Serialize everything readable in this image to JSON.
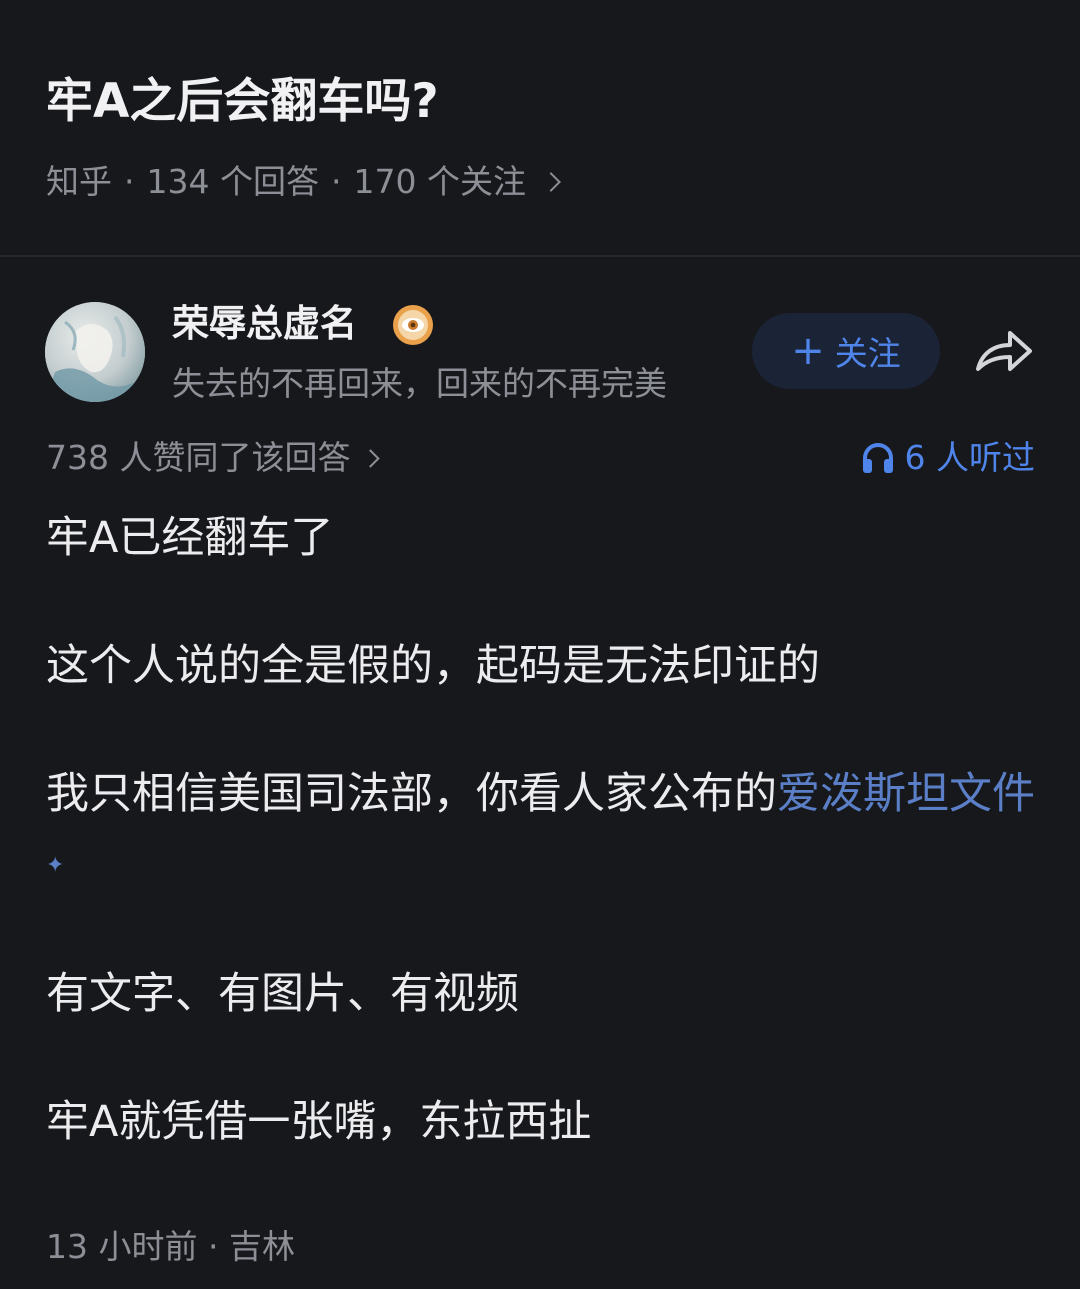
{
  "question": {
    "title": "牢A之后会翻车吗?",
    "source": "知乎",
    "answers": "134 个回答",
    "followers": "170 个关注",
    "separator": "·"
  },
  "author": {
    "name": "荣辱总虚名",
    "bio": "失去的不再回来，回来的不再完美",
    "follow_label": "关注",
    "follow_plus": "+"
  },
  "stats": {
    "votes": "738 人赞同了该回答",
    "listens": "6 人听过"
  },
  "answer": {
    "p1": "牢A已经翻车了",
    "p2": "这个人说的全是假的，起码是无法印证的",
    "p3_text": "我只相信美国司法部，你看人家公布的",
    "p3_link": "爱泼斯坦文件",
    "p4": "有文字、有图片、有视频",
    "p5": "牢A就凭借一张嘴，东拉西扯"
  },
  "footer": {
    "time_location": "13 小时前 · 吉林"
  },
  "icons": {
    "share": "share-icon",
    "headphones": "headphones-icon",
    "badge": "eye-badge-icon",
    "chevron": "chevron-right-icon"
  },
  "colors": {
    "background": "#17181c",
    "accent": "#4f84ea",
    "link": "#5b7fc7",
    "muted": "#8d8f96"
  }
}
